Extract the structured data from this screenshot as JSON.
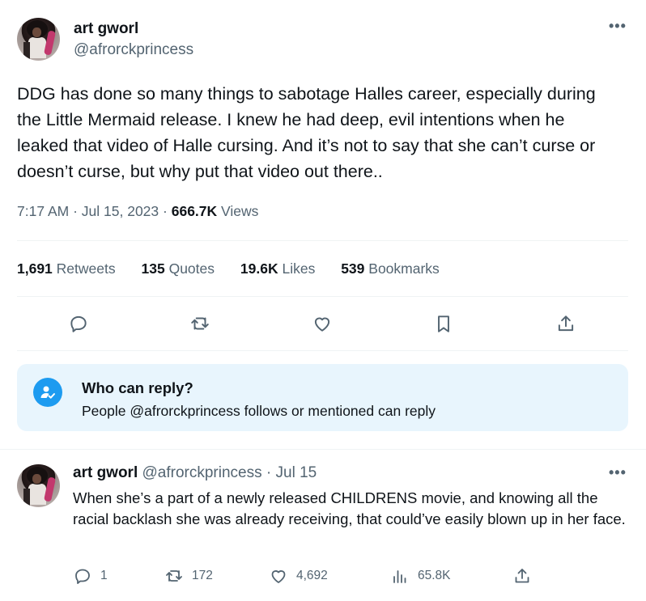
{
  "main_tweet": {
    "display_name": "art gworl",
    "handle": "@afrorckprincess",
    "more_icon": "ellipsis-icon",
    "text": "DDG has done so many things to sabotage Halles career, especially during the Little Mermaid release. I knew he had deep, evil intentions when he leaked that video of Halle cursing. And it’s not to say that she can’t curse or doesn’t curse, but why put that video out there..",
    "time": "7:17 AM",
    "date": "Jul 15, 2023",
    "views_count": "666.7K",
    "views_label": "Views",
    "stats": [
      {
        "count": "1,691",
        "label": "Retweets"
      },
      {
        "count": "135",
        "label": "Quotes"
      },
      {
        "count": "19.6K",
        "label": "Likes"
      },
      {
        "count": "539",
        "label": "Bookmarks"
      }
    ],
    "actions": [
      "reply-icon",
      "retweet-icon",
      "like-icon",
      "bookmark-icon",
      "share-icon"
    ]
  },
  "who_can_reply": {
    "title": "Who can reply?",
    "subtitle": "People @afrorckprincess follows or mentioned can reply",
    "icon": "person-check-icon",
    "accent": "#1d9bf0",
    "background": "#e8f5fd"
  },
  "reply_tweet": {
    "display_name": "art gworl",
    "handle": "@afrorckprincess",
    "date": "Jul 15",
    "text": "When she’s a part of a newly released CHILDRENS movie, and knowing all the racial backlash she was already receiving, that could’ve easily blown up in her face.",
    "replies": "1",
    "retweets": "172",
    "likes": "4,692",
    "views": "65.8K"
  },
  "colors": {
    "text_primary": "#0f1419",
    "text_secondary": "#536471",
    "divider": "#eff3f4"
  }
}
